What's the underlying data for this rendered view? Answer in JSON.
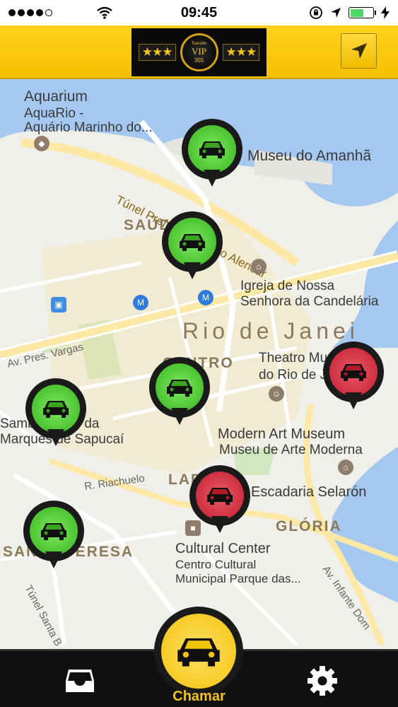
{
  "status_bar": {
    "time": "09:45",
    "battery_level": 0.6
  },
  "header": {
    "logo_stars_left": "★★★",
    "logo_stars_right": "★★★",
    "logo_top_text": "Transfer",
    "logo_brand": "VIP",
    "logo_number": "355",
    "location_icon": "navigation-arrow-icon"
  },
  "map": {
    "labels": {
      "aquarium_title": "Aquarium",
      "aquarium_line1": "AquaRio -",
      "aquarium_line2": "Aquário Marinho do...",
      "museu_amanha": "Museu do Amanhã",
      "tunnel": "Túnel Prefeito Marcello Alencar",
      "saude": "SAÚDE",
      "igreja_line1": "Igreja de Nossa",
      "igreja_line2": "Senhora da Candelária",
      "rio": "Rio de Janei",
      "av_vargas": "Av. Pres. Vargas",
      "centro": "CENTRO",
      "theatro_line1": "Theatro Municipal",
      "theatro_line2": "do Rio de Janeiro",
      "sambodromo_line1": "Sambódromo da",
      "sambodromo_line2": "Marquês de Sapucaí",
      "modern_art_title": "Modern Art Museum",
      "modern_art_sub": "Museu de Arte Moderna",
      "riachuelo": "R. Riachuelo",
      "lapa": "LAPA",
      "escadaria": "Escadaria Selarón",
      "gloria": "GLÓRIA",
      "santa_teresa": "SANTA TERESA",
      "cultural_title": "Cultural Center",
      "cultural_line1": "Centro Cultural",
      "cultural_line2": "Municipal Parque das...",
      "infante": "Av. Infante Dom",
      "tunel_santa": "Túnel Santa B"
    },
    "markers": [
      {
        "status": "available",
        "color": "#4cc22e"
      },
      {
        "status": "available",
        "color": "#4cc22e"
      },
      {
        "status": "busy",
        "color": "#d42a3a"
      },
      {
        "status": "available",
        "color": "#4cc22e"
      },
      {
        "status": "available",
        "color": "#4cc22e"
      },
      {
        "status": "busy",
        "color": "#d42a3a"
      },
      {
        "status": "available",
        "color": "#4cc22e"
      }
    ]
  },
  "bottom_bar": {
    "call_label": "Chamar",
    "inbox_icon": "inbox-tray-icon",
    "settings_icon": "gear-icon"
  },
  "colors": {
    "brand_yellow": "#f5c000",
    "water": "#a5c8f0",
    "road_major": "#fde9a5"
  }
}
